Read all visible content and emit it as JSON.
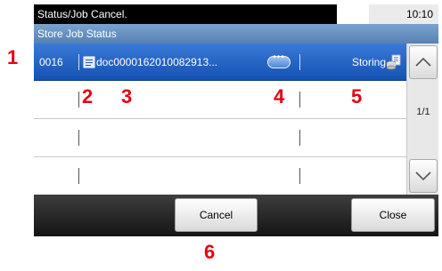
{
  "titlebar": {
    "title": "Status/Job Cancel.",
    "time": "10:10"
  },
  "subtitle": "Store Job Status",
  "jobs": [
    {
      "number": "0016",
      "name": "doc0000162010082913...",
      "status": "Storing",
      "selected": true,
      "icon": "document-icon",
      "status_icon": "storing-icon"
    },
    {
      "number": "",
      "name": "",
      "status": ""
    },
    {
      "number": "",
      "name": "",
      "status": ""
    },
    {
      "number": "",
      "name": "",
      "status": ""
    }
  ],
  "scrollbar": {
    "page_indicator": "1/1",
    "up_icon": "chevron-up-icon",
    "down_icon": "chevron-down-icon"
  },
  "footer": {
    "cancel_label": "Cancel",
    "close_label": "Close"
  },
  "callouts": {
    "c1": "1",
    "c2": "2",
    "c3": "3",
    "c4": "4",
    "c5": "5",
    "c6": "6"
  },
  "colors": {
    "selected_row": "#1e5cc2",
    "subtitle_bar": "#6a93c6",
    "callout": "#e60012"
  }
}
